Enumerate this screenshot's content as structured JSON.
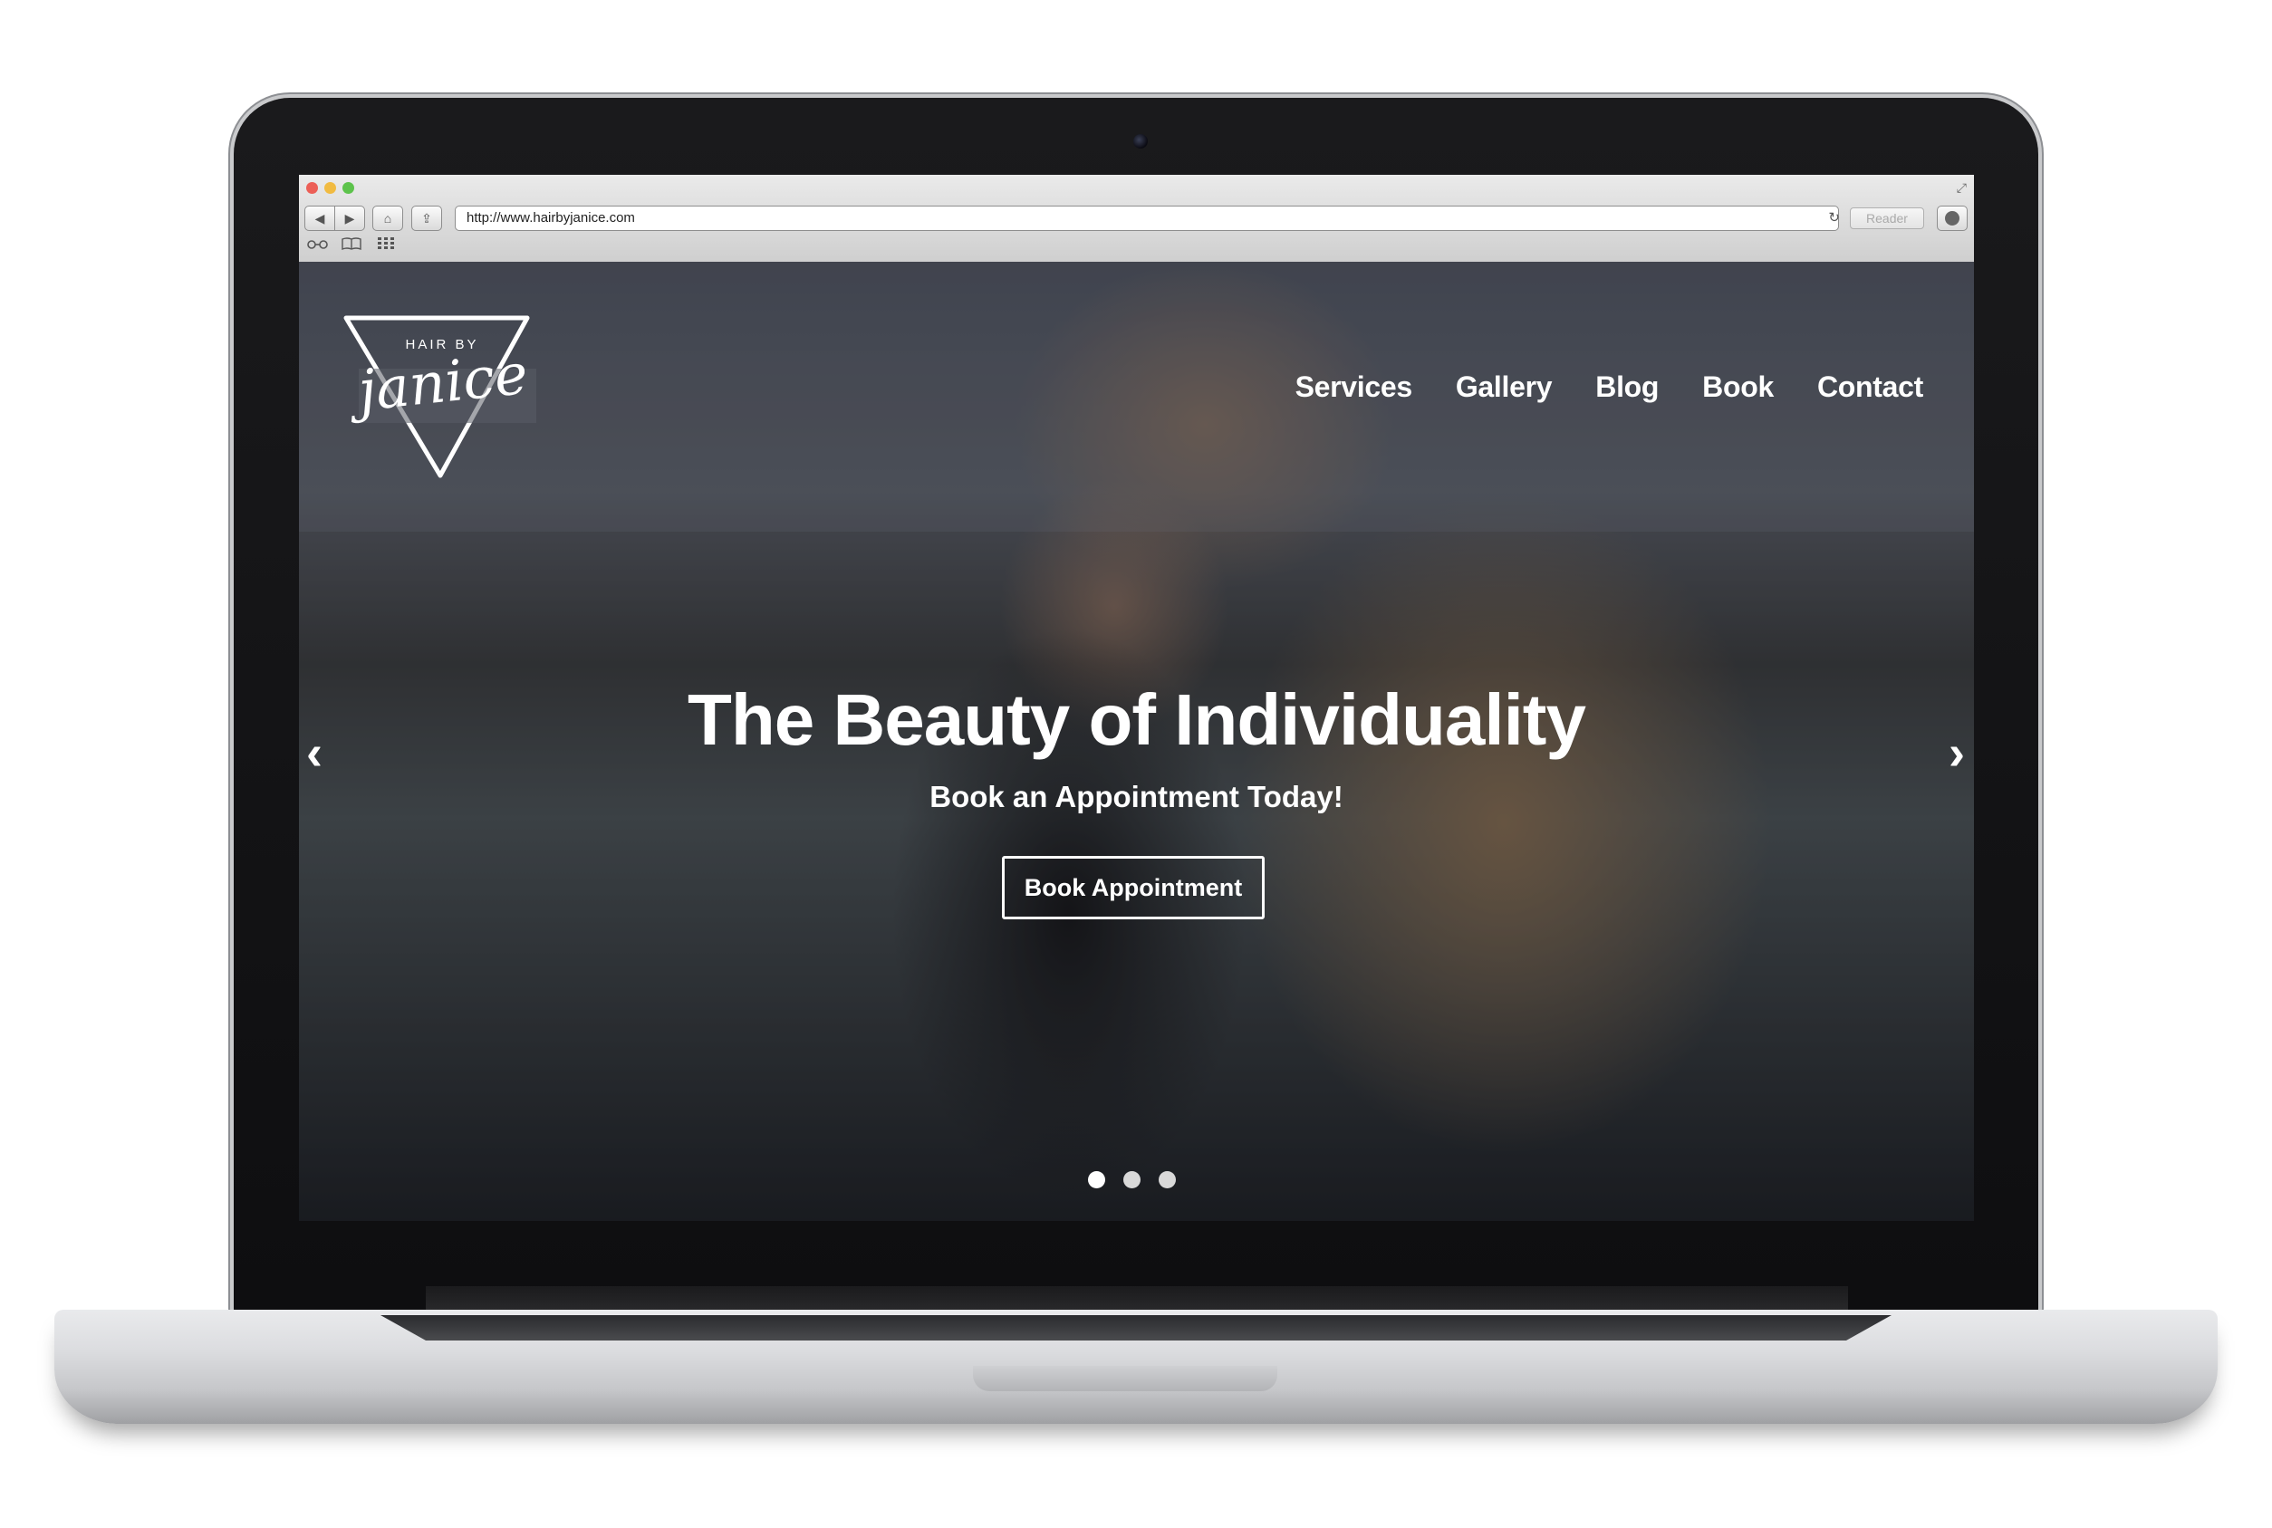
{
  "browser": {
    "url": "http://www.hairbyjanice.com",
    "reader_label": "Reader",
    "back_icon": "◀",
    "forward_icon": "▶",
    "home_icon": "⌂",
    "share_icon": "⇪",
    "refresh_icon": "↻",
    "resize_icon": "⤢",
    "bookmarks": [
      "reading-list-icon",
      "bookmarks-icon",
      "top-sites-icon"
    ]
  },
  "site": {
    "logo": {
      "small_text": "HAIR BY",
      "script_text": "janice"
    },
    "nav": [
      "Services",
      "Gallery",
      "Blog",
      "Book",
      "Contact"
    ],
    "hero": {
      "title": "The Beauty of Individuality",
      "subtitle": "Book an Appointment Today!",
      "cta_label": "Book Appointment",
      "prev_arrow": "‹",
      "next_arrow": "›"
    },
    "carousel": {
      "slides": 3,
      "active_index": 0
    }
  },
  "colors": {
    "traffic_red": "#ec5f57",
    "traffic_yellow": "#f1bb42",
    "traffic_green": "#5dc34c",
    "nav_text": "#ffffff"
  }
}
